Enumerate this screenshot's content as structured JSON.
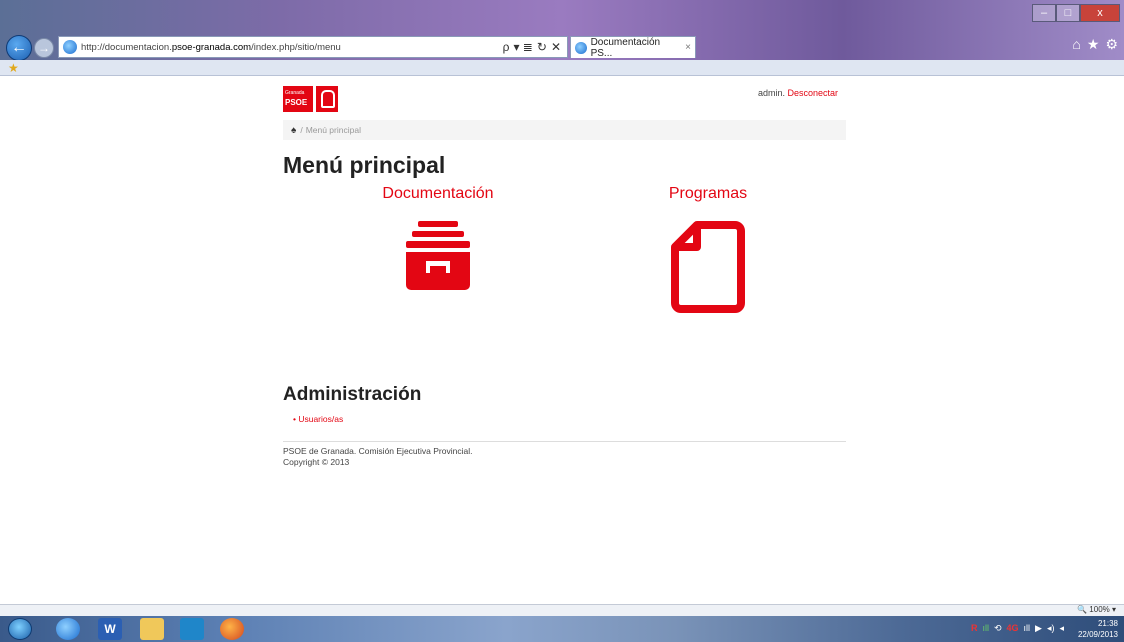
{
  "browser": {
    "url_prefix": "http://documentacion.",
    "url_domain": "psoe-granada.com",
    "url_path": "/index.php/sitio/menu",
    "tab_title": "Documentación PS...",
    "tab_close": "×",
    "search_btn": "ρ",
    "compat_btn": "▾ ≣",
    "refresh_btn": "↻",
    "stop_btn": "✕",
    "back_glyph": "←",
    "forward_glyph": "→",
    "home_glyph": "⌂",
    "favorites_glyph": "★",
    "tools_glyph": "⚙",
    "favbar_glyph": "★",
    "minimize": "–",
    "maximize": "□",
    "close": "x"
  },
  "site": {
    "logo_small": "Granada",
    "logo_text": "PSOE",
    "user": "admin.",
    "logout": "Desconectar",
    "breadcrumb_home": "♠",
    "breadcrumb_sep": "/",
    "breadcrumb_current": "Menú principal",
    "title": "Menú principal",
    "modules": [
      {
        "label": "Documentación",
        "icon": "archive-drawer-icon"
      },
      {
        "label": "Programas",
        "icon": "file-icon"
      }
    ],
    "admin_title": "Administración",
    "admin_links": [
      "Usuarios/as"
    ],
    "footer_line1": "PSOE de Granada. Comisión Ejecutiva Provincial.",
    "footer_line2": "Copyright © 2013"
  },
  "statusbar": {
    "zoom": "🔍 100%  ▾"
  },
  "taskbar": {
    "word_label": "W",
    "tray_icons": [
      "R",
      "ıll",
      "⟲",
      "4G",
      "ıll",
      "▶",
      "◂)",
      "◂"
    ],
    "time": "21:38",
    "date": "22/09/2013"
  },
  "colors": {
    "brand_red": "#e30613"
  }
}
